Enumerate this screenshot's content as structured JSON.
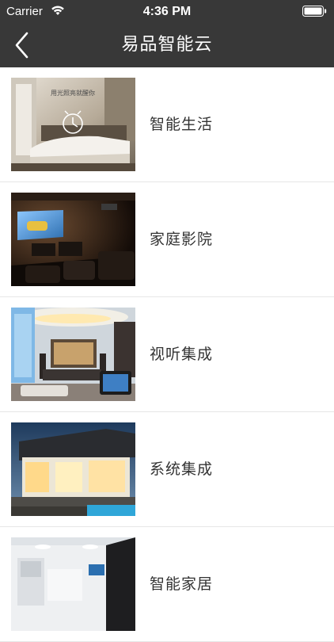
{
  "status_bar": {
    "carrier": "Carrier",
    "time": "4:36 PM",
    "wifi_icon": "wifi-icon",
    "battery_icon": "battery-icon"
  },
  "nav": {
    "title": "易品智能云",
    "back_icon": "chevron-left-icon"
  },
  "colors": {
    "header_bg": "#383838",
    "text_primary": "#333333",
    "divider": "#e6e6e6"
  },
  "items": [
    {
      "label": "智能生活",
      "thumb_caption": "用光照亮就醒你",
      "thumb": "bedroom-photo"
    },
    {
      "label": "家庭影院",
      "thumb": "home-theater-photo"
    },
    {
      "label": "视听集成",
      "thumb": "living-room-tv-photo"
    },
    {
      "label": "系统集成",
      "thumb": "modern-house-exterior-photo"
    },
    {
      "label": "智能家居",
      "thumb": "white-interior-photo"
    }
  ]
}
